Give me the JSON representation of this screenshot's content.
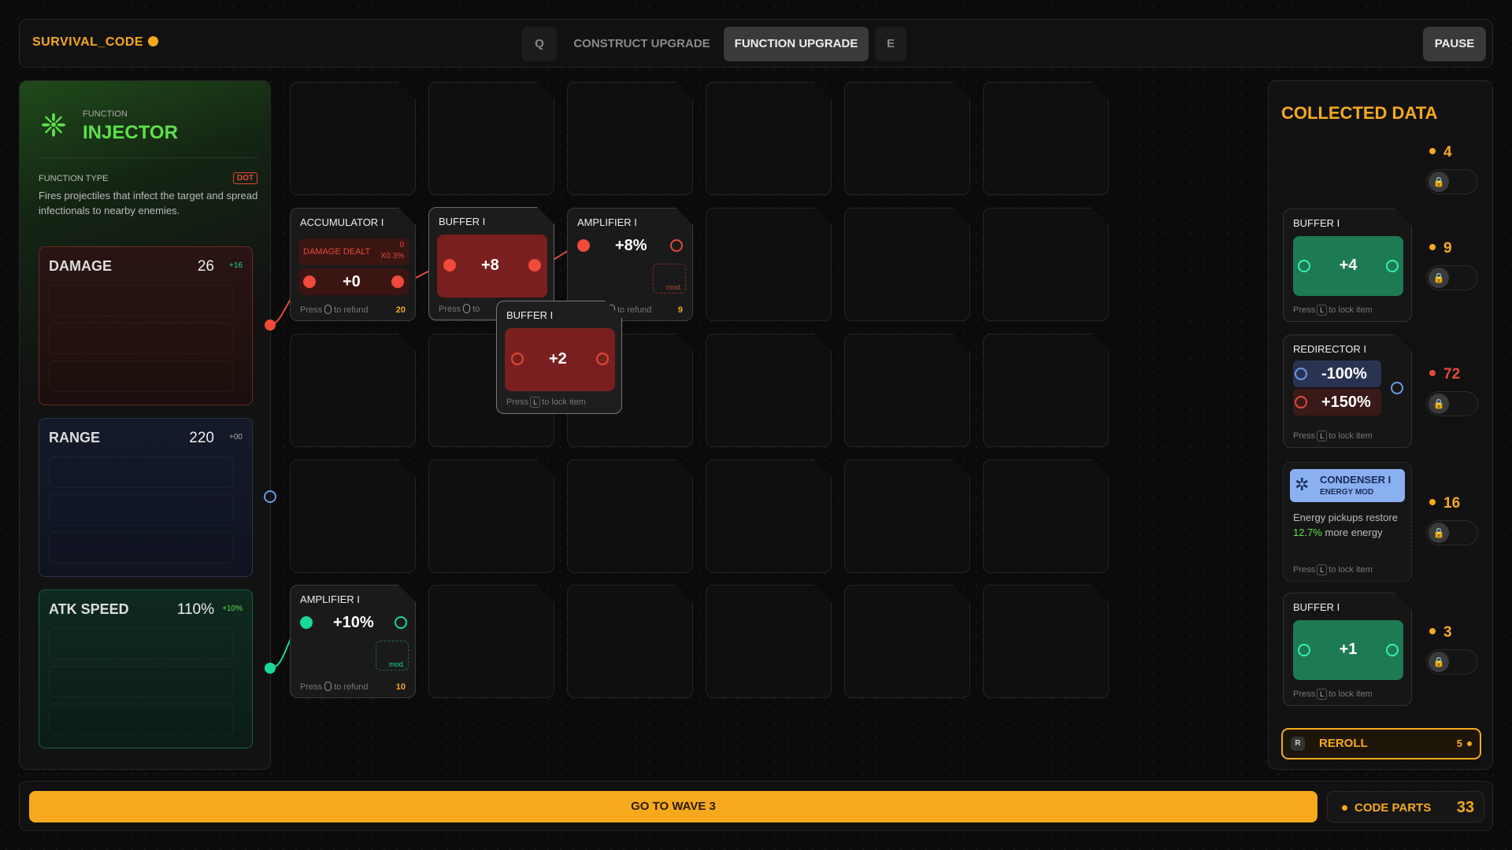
{
  "topbar": {
    "brand": "SURVIVAL_CODE",
    "tab_q": "Q",
    "tab_construct": "CONSTRUCT UPGRADE",
    "tab_function": "FUNCTION UPGRADE",
    "tab_e": "E",
    "pause": "PAUSE"
  },
  "function": {
    "kind": "FUNCTION",
    "name": "INJECTOR",
    "type_label": "FUNCTION TYPE",
    "type_badge": "DOT",
    "description": "Fires projectiles that infect the target and spread infectionals to nearby enemies.",
    "stats": [
      {
        "name": "DAMAGE",
        "value": "26",
        "bonus": "+16",
        "color": "#19d99a"
      },
      {
        "name": "RANGE",
        "value": "220",
        "bonus": "+00",
        "color": "#aaaaaa"
      },
      {
        "name": "ATK SPEED",
        "value": "110%",
        "bonus": "+10%",
        "color": "#5ee04a"
      }
    ]
  },
  "grid": {
    "accumulator": {
      "title": "ACCUMULATOR I",
      "damage_label": "DAMAGE DEALT",
      "damage_zero": "0",
      "damage_mult": "X0.3%",
      "value": "+0",
      "foot_press": "Press",
      "foot_action": "to refund",
      "cost": "20"
    },
    "buffer_a": {
      "title": "BUFFER I",
      "value": "+8",
      "foot_press": "Press",
      "foot_action": "to"
    },
    "amplifier_a": {
      "title": "AMPLIFIER I",
      "value": "+8%",
      "mod": "mod.",
      "foot_action": "to refund",
      "cost": "9"
    },
    "buffer_float": {
      "title": "BUFFER I",
      "value": "+2",
      "foot_press": "Press",
      "foot_key": "L",
      "foot_action": "to lock item"
    },
    "amplifier_b": {
      "title": "AMPLIFIER I",
      "value": "+10%",
      "mod": "mod.",
      "foot_press": "Press",
      "foot_action": "to refund",
      "cost": "10"
    }
  },
  "collected": {
    "title": "COLLECTED DATA",
    "top_price": "4",
    "items": [
      {
        "title": "BUFFER I",
        "value": "+4",
        "foot_press": "Press",
        "foot_key": "L",
        "foot_action": "to lock item",
        "price": "9"
      },
      {
        "title": "REDIRECTOR I",
        "value_a": "-100%",
        "value_b": "+150%",
        "foot_press": "Press",
        "foot_key": "L",
        "foot_action": "to lock item",
        "price": "72",
        "price_color": "#e24a3a"
      },
      {
        "title": "CONDENSER I",
        "subtitle": "ENERGY MOD",
        "desc_a": "Energy pickups restore ",
        "desc_highlight": "12.7%",
        "desc_b": " more energy",
        "foot_press": "Press",
        "foot_key": "L",
        "foot_action": "to lock item",
        "price": "16"
      },
      {
        "title": "BUFFER I",
        "value": "+1",
        "foot_press": "Press",
        "foot_key": "L",
        "foot_action": "to lock item",
        "price": "3"
      }
    ],
    "reroll_key": "R",
    "reroll_label": "REROLL",
    "reroll_cost": "5"
  },
  "bottom": {
    "go_wave": "GO TO WAVE 3",
    "parts_label": "CODE PARTS",
    "parts_value": "33"
  },
  "colors": {
    "accent": "#f7a91d",
    "red": "#e24a3a",
    "green": "#19d99a",
    "function_green": "#5ee04a"
  }
}
